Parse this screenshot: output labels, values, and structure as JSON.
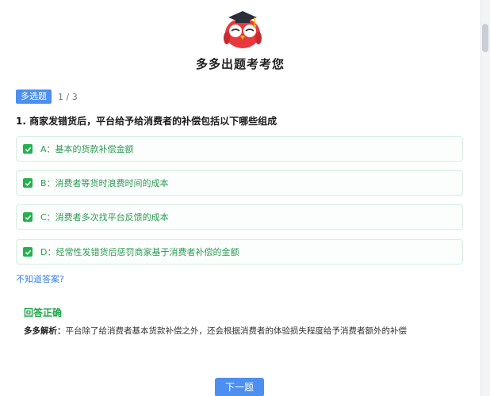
{
  "header": {
    "title": "多多出题考考您"
  },
  "quiz": {
    "type_badge": "多选题",
    "progress": "1 / 3",
    "question": "1. 商家发错货后，平台给予给消费者的补偿包括以下哪些组成",
    "options": [
      {
        "label": "A：基本的货款补偿金额",
        "checked": true
      },
      {
        "label": "B：消费者等货时浪费时间的成本",
        "checked": true
      },
      {
        "label": "C：消费者多次找平台反馈的成本",
        "checked": true
      },
      {
        "label": "D：经常性发错货后惩罚商家基于消费者补偿的金额",
        "checked": true
      }
    ],
    "unknown_link": "不知道答案?",
    "result": "回答正确",
    "analysis_label": "多多解析：",
    "analysis_text": "平台除了给消费者基本货款补偿之外，还会根据消费者的体验损失程度给予消费者额外的补偿",
    "next_button": "下一题"
  },
  "colors": {
    "accent_blue": "#4c8ff0",
    "correct_green": "#22b24c",
    "mascot_red": "#e8383d"
  }
}
